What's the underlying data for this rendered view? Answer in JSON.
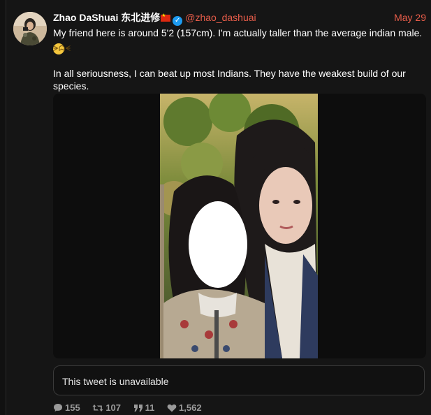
{
  "author": {
    "display_name": "Zhao DaShuai 东北进修",
    "handle": "@zhao_dashuai",
    "verified": true,
    "flag": "china-flag"
  },
  "tweet": {
    "date": "May 29",
    "paragraph_1": "My friend here is around 5'2 (157cm).  I'm actually taller than the average indian male.",
    "paragraph_2": "In all seriousness, I can beat up most Indians. They have the weakest build of our species.",
    "emoji": "grinning-squinting-face"
  },
  "quoted_tweet": {
    "text": "This tweet is unavailable"
  },
  "stats": {
    "replies": "155",
    "retweets": "107",
    "quotes": "11",
    "likes": "1,562"
  },
  "colors": {
    "accent": "#e85d4a",
    "verified": "#1d9bf0",
    "background": "#151515"
  }
}
